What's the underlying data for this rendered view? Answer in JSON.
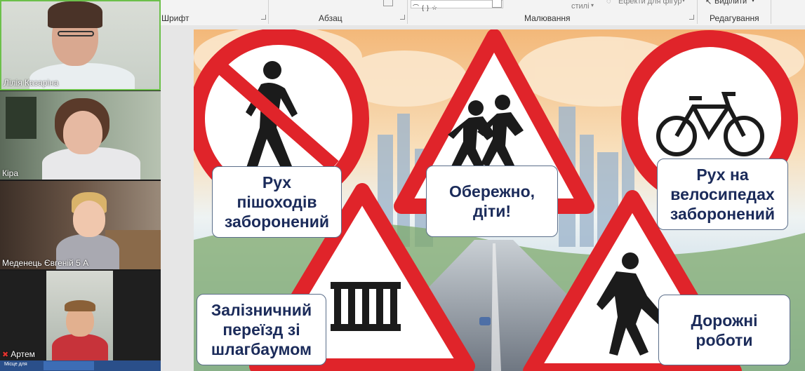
{
  "ribbon": {
    "font_group": "Шрифт",
    "paragraph_group": "Абзац",
    "drawing_group": "Малювання",
    "editing_group": "Редагування",
    "styles_label": "стилі",
    "shape_effects_label": "Ефекти для фігур",
    "select_label": "Виділити"
  },
  "participants": [
    {
      "name": "Лілія Казаріна",
      "muted": false
    },
    {
      "name": "Кіра",
      "muted": false
    },
    {
      "name": "Меденець Євгеній 5 А",
      "muted": false
    },
    {
      "name": "Артем",
      "muted": true
    }
  ],
  "strip_bottom": {
    "mini_text": "Місце для"
  },
  "slide": {
    "signs": [
      {
        "id": "no-pedestrians",
        "label": "Рух\nпішоходів\nзаборонений"
      },
      {
        "id": "children",
        "label": "Обережно,\nдіти!"
      },
      {
        "id": "no-bicycles",
        "label": "Рух на\nвелосипедах\nзаборонений"
      },
      {
        "id": "railway-crossing-barrier",
        "label": "Залізничний\nпереїзд зі\nшлагбаумом"
      },
      {
        "id": "road-works",
        "label": "Дорожні\nроботи"
      }
    ]
  },
  "colors": {
    "sign_red": "#e0242a",
    "label_text": "#1b2b5a",
    "active_speaker_border": "#6cc04a"
  }
}
